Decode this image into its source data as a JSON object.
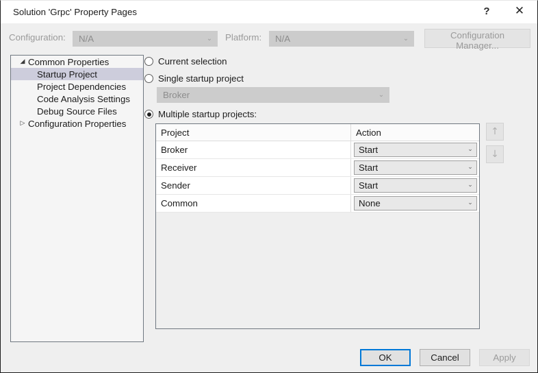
{
  "window": {
    "title": "Solution 'Grpc' Property Pages",
    "help_icon": "help-icon",
    "help_glyph": "?",
    "close_icon": "close-icon",
    "close_glyph": "✕",
    "accent_color": "#0078d7",
    "background_color": "#efefef",
    "selection_color": "#cdcddc"
  },
  "config_bar": {
    "configuration_label": "Configuration:",
    "configuration_value": "N/A",
    "platform_label": "Platform:",
    "platform_value": "N/A",
    "configuration_manager_label": "Configuration Manager...",
    "chevron": "⌄"
  },
  "tree": {
    "items": [
      {
        "label": "Common Properties",
        "level": 0,
        "expander": "◢",
        "selected": false
      },
      {
        "label": "Startup Project",
        "level": 1,
        "expander": "",
        "selected": true
      },
      {
        "label": "Project Dependencies",
        "level": 1,
        "expander": "",
        "selected": false
      },
      {
        "label": "Code Analysis Settings",
        "level": 1,
        "expander": "",
        "selected": false
      },
      {
        "label": "Debug Source Files",
        "level": 1,
        "expander": "",
        "selected": false
      },
      {
        "label": "Configuration Properties",
        "level": 0,
        "expander": "▷",
        "selected": false
      }
    ]
  },
  "options": {
    "current_selection_label": "Current selection",
    "single_startup_label": "Single startup project",
    "single_startup_value": "Broker",
    "multiple_startup_label": "Multiple startup projects:",
    "selected": "multiple"
  },
  "grid": {
    "columns": [
      "Project",
      "Action"
    ],
    "rows": [
      {
        "project": "Broker",
        "action": "Start"
      },
      {
        "project": "Receiver",
        "action": "Start"
      },
      {
        "project": "Sender",
        "action": "Start"
      },
      {
        "project": "Common",
        "action": "None"
      }
    ],
    "chevron": "⌄"
  },
  "move_buttons": {
    "up_icon": "arrow-up-icon",
    "up_glyph": "↑",
    "down_icon": "arrow-down-icon",
    "down_glyph": "↓"
  },
  "footer": {
    "ok_label": "OK",
    "cancel_label": "Cancel",
    "apply_label": "Apply"
  }
}
